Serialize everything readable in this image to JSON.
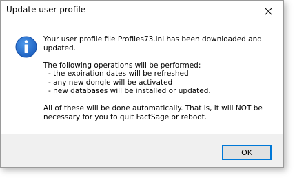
{
  "window": {
    "title": "Update user profile"
  },
  "icons": {
    "close": "close-icon",
    "info": "info-icon"
  },
  "message": {
    "line1": "Your user profile file Profiles73.ini has been downloaded and updated.",
    "intro": "The following operations will be performed:",
    "items": [
      "- the expiration dates will be refreshed",
      "- any new dongle will be activated",
      "- new databases will be installed or updated."
    ],
    "closing": "All of these will be done automatically. That is, it will NOT be necessary for you to quit FactSage or reboot."
  },
  "buttons": {
    "ok_label": "OK"
  },
  "colors": {
    "accent": "#0078d7",
    "info_icon": "#1c68c9",
    "footer_bg": "#f0f0f0"
  }
}
